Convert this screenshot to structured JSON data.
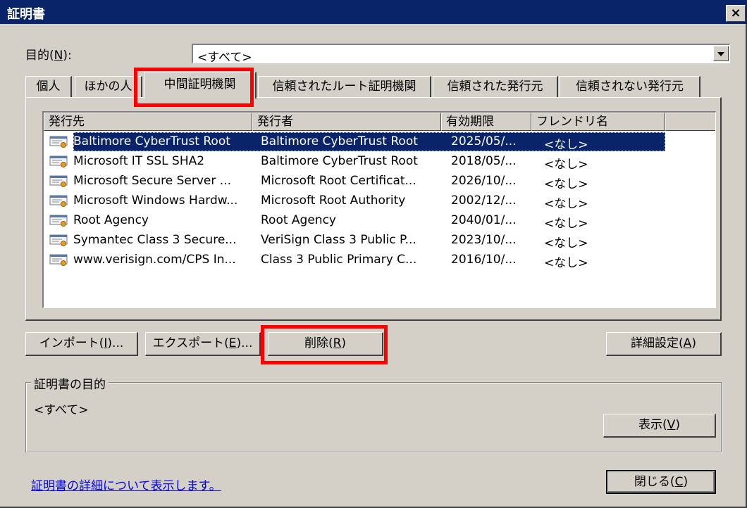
{
  "window": {
    "title": "証明書",
    "close_label": "×"
  },
  "purpose": {
    "label": "目的(N):",
    "value": "<すべて>"
  },
  "tabs": [
    {
      "label": "個人"
    },
    {
      "label": "ほかの人"
    },
    {
      "label": "中間証明機関"
    },
    {
      "label": "信頼されたルート証明機関"
    },
    {
      "label": "信頼された発行元"
    },
    {
      "label": "信頼されない発行元"
    }
  ],
  "columns": [
    "発行先",
    "発行者",
    "有効期限",
    "フレンドリ名"
  ],
  "rows": [
    {
      "issued_to": "Baltimore CyberTrust Root",
      "issued_by": "Baltimore CyberTrust Root",
      "expires": "2025/05/...",
      "friendly": "<なし>"
    },
    {
      "issued_to": "Microsoft IT SSL SHA2",
      "issued_by": "Baltimore CyberTrust Root",
      "expires": "2018/05/...",
      "friendly": "<なし>"
    },
    {
      "issued_to": "Microsoft Secure Server ...",
      "issued_by": "Microsoft Root Certificat...",
      "expires": "2026/10/...",
      "friendly": "<なし>"
    },
    {
      "issued_to": "Microsoft Windows Hardw...",
      "issued_by": "Microsoft Root Authority",
      "expires": "2002/12/...",
      "friendly": "<なし>"
    },
    {
      "issued_to": "Root Agency",
      "issued_by": "Root Agency",
      "expires": "2040/01/...",
      "friendly": "<なし>"
    },
    {
      "issued_to": "Symantec Class 3 Secure...",
      "issued_by": "VeriSign Class 3 Public P...",
      "expires": "2023/10/...",
      "friendly": "<なし>"
    },
    {
      "issued_to": "www.verisign.com/CPS In...",
      "issued_by": "Class 3 Public Primary C...",
      "expires": "2016/10/...",
      "friendly": "<なし>"
    }
  ],
  "selected_row": 0,
  "buttons": {
    "import_label": "インポート(",
    "import_key": "I",
    "import_suffix": ")...",
    "export_label": "エクスポート(",
    "export_key": "E",
    "export_suffix": ")...",
    "delete_label": "削除(",
    "delete_key": "R",
    "delete_suffix": ")",
    "advanced_label": "詳細設定(",
    "advanced_key": "A",
    "advanced_suffix": ")",
    "view_label": "表示(",
    "view_key": "V",
    "view_suffix": ")",
    "close_label": "閉じる(",
    "close_key": "C",
    "close_suffix": ")"
  },
  "purpose_group": {
    "title": "証明書の目的",
    "value": "<すべて>"
  },
  "link_text": "証明書の詳細について表示します。",
  "colors": {
    "titlebar": "#0a246a",
    "face": "#d4d0c8",
    "selection": "#0a246a",
    "highlight": "#ff0000"
  }
}
